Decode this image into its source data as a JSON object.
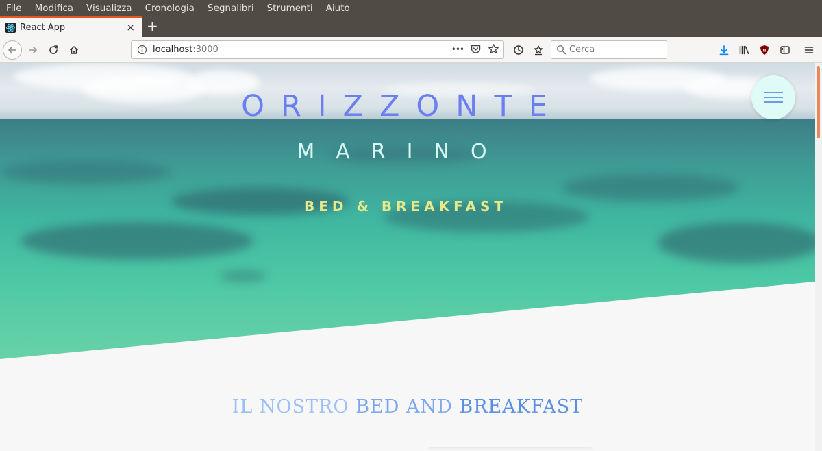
{
  "menubar": {
    "items": [
      {
        "first": "F",
        "rest": "ile"
      },
      {
        "first": "M",
        "rest": "odifica"
      },
      {
        "first": "V",
        "rest": "isualizza"
      },
      {
        "first": "C",
        "rest": "ronologia"
      },
      {
        "first": "S",
        "rest": "egnalibri"
      },
      {
        "first": "S",
        "rest": "trumenti"
      },
      {
        "first": "A",
        "rest": "iuto"
      }
    ]
  },
  "tab": {
    "title": "React App",
    "favicon": "react-icon",
    "close": "×"
  },
  "newtab": "+",
  "navbar": {
    "url_host": "localhost",
    "url_port": ":3000",
    "page_actions": "•••",
    "search_placeholder": "Cerca"
  },
  "hero": {
    "title": "ORIZZONTE",
    "subtitle": "MARINO",
    "tagline": "BED & BREAKFAST"
  },
  "section": {
    "part1": "IL NOSTRO",
    "part2": "BED AND",
    "part3": "BREAKFAST"
  },
  "colors": {
    "brand_title": "#6c7ff0",
    "brand_subtitle": "#d6f7f3",
    "brand_tagline": "#e7e889",
    "hamburger_bg": "#dffbf7",
    "accent": "#e95420"
  }
}
